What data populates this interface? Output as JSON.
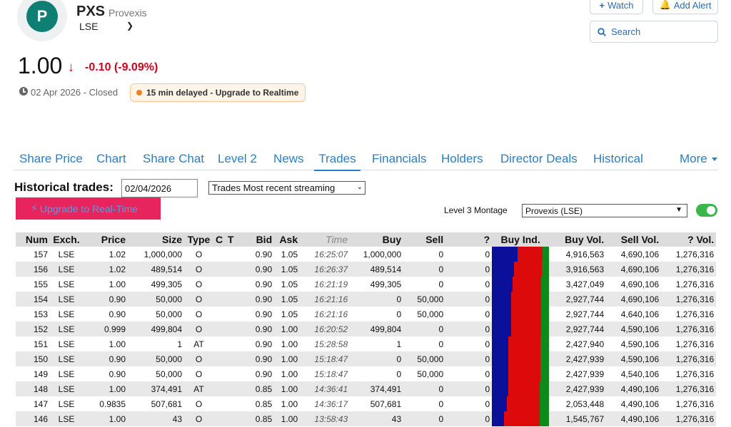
{
  "header": {
    "logo_letter": "P",
    "ticker": "PXS",
    "company": "Provexis",
    "exchange": "LSE",
    "watch_label": "Watch",
    "alert_label": "Add Alert",
    "search_placeholder": "Search"
  },
  "quote": {
    "price": "1.00",
    "change": "-0.10 (-9.09%)",
    "date_status": "02 Apr 2026 - Closed",
    "delay_badge": "15 min delayed - Upgrade to Realtime",
    "colors": {
      "down": "#d0021b",
      "badge_dot": "#f57c1f"
    }
  },
  "tabs": [
    "Share Price",
    "Chart",
    "Share Chat",
    "Level 2",
    "News",
    "Trades",
    "Financials",
    "Holders",
    "Director Deals",
    "Historical",
    "More"
  ],
  "active_tab": "Trades",
  "controls": {
    "historical_label": "Historical trades:",
    "date_value": "02/04/2026",
    "mode_selected": "Trades Most recent streaming",
    "upgrade_label": "Upgrade to Real-Time",
    "level3_label": "Level 3 Montage",
    "montage_selected": "Provexis (LSE)",
    "toggle_on": true
  },
  "table": {
    "columns": [
      "Num",
      "Exch.",
      "Price",
      "Size",
      "Type",
      "C",
      "T",
      "Bid",
      "Ask",
      "Time",
      "Buy",
      "Sell",
      "?",
      "Buy Ind.",
      "Buy Vol.",
      "Sell Vol.",
      "? Vol."
    ],
    "rows": [
      {
        "num": "157",
        "exch": "LSE",
        "price": "1.02",
        "size": "1,000,000",
        "type": "O",
        "c": "",
        "t": "",
        "bid": "0.90",
        "ask": "1.05",
        "time": "16:25:07",
        "buy": "1,000,000",
        "sell": "0",
        "q": "0",
        "buy_vol": "4,916,563",
        "sell_vol": "4,690,106",
        "q_vol": "1,276,316",
        "ind": {
          "buy": 0.45,
          "sell": 0.43,
          "unknown": 0.12
        }
      },
      {
        "num": "156",
        "exch": "LSE",
        "price": "1.02",
        "size": "489,514",
        "type": "O",
        "c": "",
        "t": "",
        "bid": "0.90",
        "ask": "1.05",
        "time": "16:26:37",
        "buy": "489,514",
        "sell": "0",
        "q": "0",
        "buy_vol": "3,916,563",
        "sell_vol": "4,690,106",
        "q_vol": "1,276,316",
        "ind": {
          "buy": 0.39,
          "sell": 0.48,
          "unknown": 0.13
        }
      },
      {
        "num": "155",
        "exch": "LSE",
        "price": "1.00",
        "size": "499,305",
        "type": "O",
        "c": "",
        "t": "",
        "bid": "0.90",
        "ask": "1.05",
        "time": "16:21:19",
        "buy": "499,305",
        "sell": "0",
        "q": "0",
        "buy_vol": "3,427,049",
        "sell_vol": "4,690,106",
        "q_vol": "1,276,316",
        "ind": {
          "buy": 0.36,
          "sell": 0.5,
          "unknown": 0.14
        }
      },
      {
        "num": "154",
        "exch": "LSE",
        "price": "0.90",
        "size": "50,000",
        "type": "O",
        "c": "",
        "t": "",
        "bid": "0.90",
        "ask": "1.05",
        "time": "16:21:16",
        "buy": "0",
        "sell": "50,000",
        "q": "0",
        "buy_vol": "2,927,744",
        "sell_vol": "4,690,106",
        "q_vol": "1,276,316",
        "ind": {
          "buy": 0.33,
          "sell": 0.53,
          "unknown": 0.14
        }
      },
      {
        "num": "153",
        "exch": "LSE",
        "price": "0.90",
        "size": "50,000",
        "type": "O",
        "c": "",
        "t": "",
        "bid": "0.90",
        "ask": "1.05",
        "time": "16:21:16",
        "buy": "0",
        "sell": "50,000",
        "q": "0",
        "buy_vol": "2,927,744",
        "sell_vol": "4,640,106",
        "q_vol": "1,276,316",
        "ind": {
          "buy": 0.33,
          "sell": 0.53,
          "unknown": 0.14
        }
      },
      {
        "num": "152",
        "exch": "LSE",
        "price": "0.999",
        "size": "499,804",
        "type": "O",
        "c": "",
        "t": "",
        "bid": "0.90",
        "ask": "1.00",
        "time": "16:20:52",
        "buy": "499,804",
        "sell": "0",
        "q": "0",
        "buy_vol": "2,927,744",
        "sell_vol": "4,590,106",
        "q_vol": "1,276,316",
        "ind": {
          "buy": 0.33,
          "sell": 0.53,
          "unknown": 0.14
        }
      },
      {
        "num": "151",
        "exch": "LSE",
        "price": "1.00",
        "size": "1",
        "type": "AT",
        "c": "",
        "t": "",
        "bid": "0.90",
        "ask": "1.00",
        "time": "15:28:58",
        "buy": "1",
        "sell": "0",
        "q": "0",
        "buy_vol": "2,427,940",
        "sell_vol": "4,590,106",
        "q_vol": "1,276,316",
        "ind": {
          "buy": 0.29,
          "sell": 0.56,
          "unknown": 0.15
        }
      },
      {
        "num": "150",
        "exch": "LSE",
        "price": "0.90",
        "size": "50,000",
        "type": "O",
        "c": "",
        "t": "",
        "bid": "0.90",
        "ask": "1.00",
        "time": "15:18:47",
        "buy": "0",
        "sell": "50,000",
        "q": "0",
        "buy_vol": "2,427,939",
        "sell_vol": "4,590,106",
        "q_vol": "1,276,316",
        "ind": {
          "buy": 0.29,
          "sell": 0.56,
          "unknown": 0.15
        }
      },
      {
        "num": "149",
        "exch": "LSE",
        "price": "0.90",
        "size": "50,000",
        "type": "O",
        "c": "",
        "t": "",
        "bid": "0.90",
        "ask": "1.00",
        "time": "15:18:47",
        "buy": "0",
        "sell": "50,000",
        "q": "0",
        "buy_vol": "2,427,939",
        "sell_vol": "4,540,106",
        "q_vol": "1,276,316",
        "ind": {
          "buy": 0.29,
          "sell": 0.56,
          "unknown": 0.15
        }
      },
      {
        "num": "148",
        "exch": "LSE",
        "price": "1.00",
        "size": "374,491",
        "type": "AT",
        "c": "",
        "t": "",
        "bid": "0.85",
        "ask": "1.00",
        "time": "14:36:41",
        "buy": "374,491",
        "sell": "0",
        "q": "0",
        "buy_vol": "2,427,939",
        "sell_vol": "4,490,106",
        "q_vol": "1,276,316",
        "ind": {
          "buy": 0.29,
          "sell": 0.55,
          "unknown": 0.16
        }
      },
      {
        "num": "147",
        "exch": "LSE",
        "price": "0.9835",
        "size": "507,681",
        "type": "O",
        "c": "",
        "t": "",
        "bid": "0.85",
        "ask": "1.00",
        "time": "14:36:17",
        "buy": "507,681",
        "sell": "0",
        "q": "0",
        "buy_vol": "2,053,448",
        "sell_vol": "4,490,106",
        "q_vol": "1,276,316",
        "ind": {
          "buy": 0.26,
          "sell": 0.58,
          "unknown": 0.16
        }
      },
      {
        "num": "146",
        "exch": "LSE",
        "price": "1.00",
        "size": "43",
        "type": "O",
        "c": "",
        "t": "",
        "bid": "0.85",
        "ask": "1.00",
        "time": "13:58:43",
        "buy": "43",
        "sell": "0",
        "q": "0",
        "buy_vol": "1,545,767",
        "sell_vol": "4,490,106",
        "q_vol": "1,276,316",
        "ind": {
          "buy": 0.21,
          "sell": 0.63,
          "unknown": 0.16
        }
      }
    ]
  },
  "indicator_colors": {
    "buy": "#0b109a",
    "sell": "#dc0a0a",
    "unknown": "#0e8a1c"
  }
}
